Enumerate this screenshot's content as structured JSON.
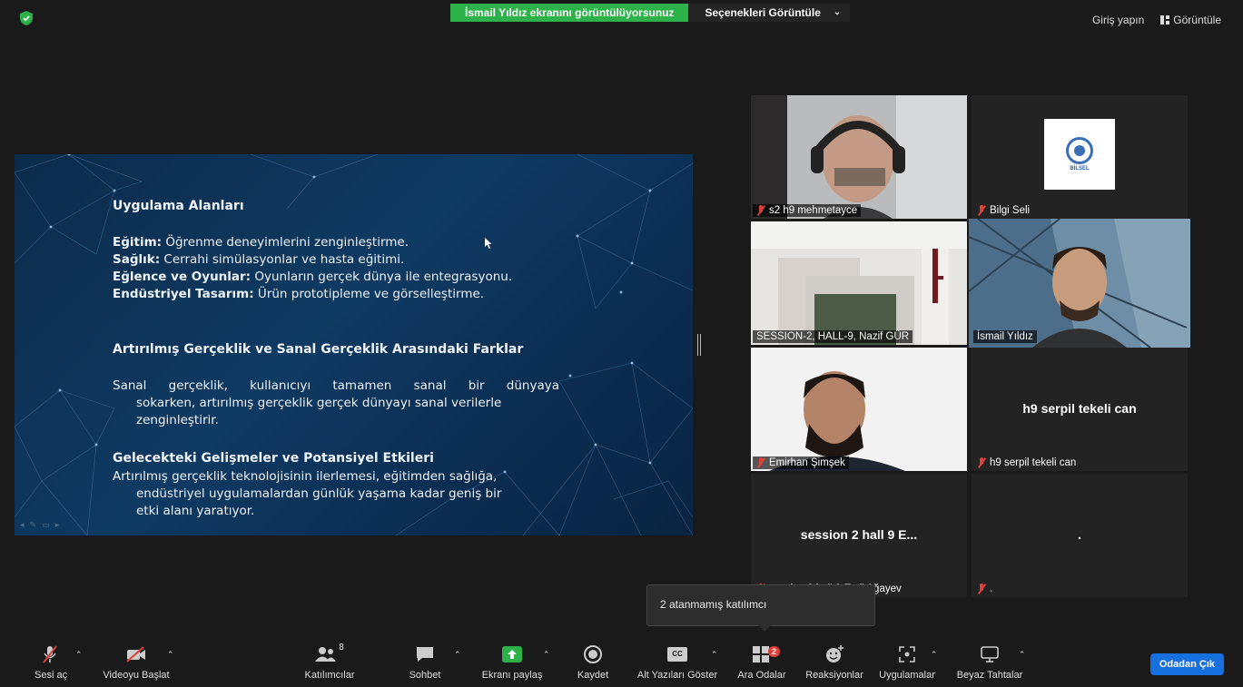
{
  "top": {
    "share_banner": "İsmail Yıldız ekranını görüntülüyorsunuz",
    "view_options": "Seçenekleri Görüntüle",
    "sign_in": "Giriş yapın",
    "view": "Görüntüle"
  },
  "slide": {
    "heading1": "Uygulama Alanları",
    "bullets": [
      {
        "bold": "Eğitim:",
        "text": " Öğrenme deneyimlerini zenginleştirme."
      },
      {
        "bold": "Sağlık:",
        "text": " Cerrahi simülasyonlar ve hasta eğitimi."
      },
      {
        "bold": "Eğlence ve Oyunlar:",
        "text": " Oyunların gerçek dünya ile entegrasyonu."
      },
      {
        "bold": "Endüstriyel Tasarım:",
        "text": " Ürün prototipleme ve görselleştirme."
      }
    ],
    "heading2": "Artırılmış Gerçeklik ve Sanal Gerçeklik Arasındaki Farklar",
    "para1": [
      "Sanal gerçeklik, kullanıcıyı tamamen sanal bir dünyaya",
      "sokarken, artırılmış gerçeklik gerçek dünyayı sanal verilerle",
      "zenginleştirir."
    ],
    "heading3": "Gelecekteki Gelişmeler ve Potansiyel Etkileri",
    "para2": [
      "Artırılmış gerçeklik teknolojisinin ilerlemesi, eğitimden sağlığa,",
      "endüstriyel uygulamalardan günlük yaşama kadar geniş bir",
      "etki alanı yaratıyor."
    ]
  },
  "participants": [
    {
      "name": "s2 h9 mehmetayce",
      "muted": true
    },
    {
      "name": "Bilgi Seli",
      "muted": true,
      "logo_text": "BİLSEL"
    },
    {
      "name": "SESSION-2, HALL-9, Nazif GÜR",
      "muted": false
    },
    {
      "name": "İsmail Yıldız",
      "muted": false,
      "active_speaker": true
    },
    {
      "name": "Emirhan Şimşek",
      "muted": true
    },
    {
      "name": "h9 serpil tekeli can",
      "muted": true,
      "center": "h9 serpil tekeli can"
    },
    {
      "name": "session 2 hall 9 Emil Ağayev",
      "muted": true,
      "center": "session 2 hall 9 E..."
    },
    {
      "name": ".",
      "muted": true,
      "center": "."
    }
  ],
  "tooltip": "2 atanmamış katılımcı",
  "toolbar": {
    "unmute": "Sesi aç",
    "start_video": "Videoyu Başlat",
    "participants": "Katılımcılar",
    "participants_count": "8",
    "chat": "Sohbet",
    "share": "Ekranı paylaş",
    "record": "Kaydet",
    "captions": "Alt Yazıları Göster",
    "captions_icon_text": "CC",
    "breakout": "Ara Odalar",
    "breakout_badge": "2",
    "reactions": "Reaksiyonlar",
    "apps": "Uygulamalar",
    "whiteboards": "Beyaz Tahtalar",
    "leave": "Odadan Çık"
  },
  "colors": {
    "share_green": "#2db24a",
    "leave_blue": "#1670e0",
    "active_outline": "#c9e866",
    "muted_red": "#e0403a"
  }
}
